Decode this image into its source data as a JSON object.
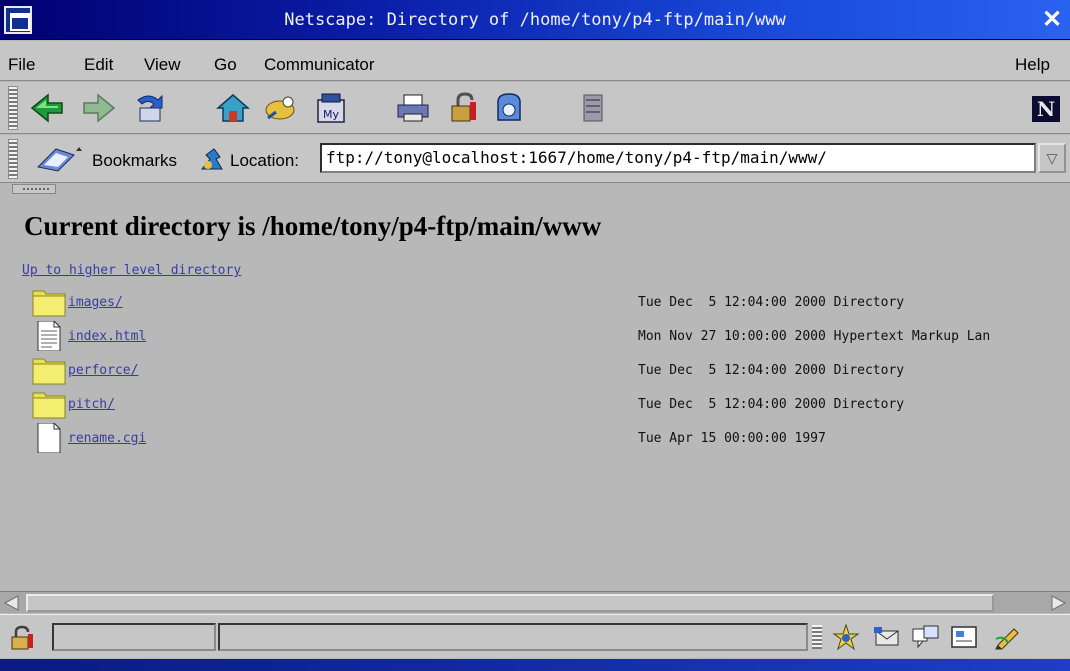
{
  "window": {
    "title": "Netscape: Directory of /home/tony/p4-ftp/main/www",
    "close_glyph": "✕"
  },
  "menu": {
    "items": [
      "File",
      "Edit",
      "View",
      "Go",
      "Communicator"
    ],
    "help": "Help"
  },
  "toolbar": {
    "buttons": [
      "back-icon",
      "forward-icon",
      "reload-icon",
      "home-icon",
      "search-icon",
      "my-netscape-icon",
      "print-icon",
      "security-icon",
      "shop-icon",
      "stop-icon"
    ],
    "my_label": "My",
    "brand_letter": "N"
  },
  "location_bar": {
    "bookmarks_label": "Bookmarks",
    "location_label": "Location:",
    "url": "ftp://tony@localhost:1667/home/tony/p4-ftp/main/www/"
  },
  "page": {
    "heading": "Current directory is /home/tony/p4-ftp/main/www",
    "up_link": "Up to higher level directory",
    "entries": [
      {
        "name": "images/",
        "icon": "folder-icon",
        "info": "Tue Dec  5 12:04:00 2000 Directory"
      },
      {
        "name": "index.html",
        "icon": "document-icon",
        "info": "Mon Nov 27 10:00:00 2000 Hypertext Markup Lan"
      },
      {
        "name": "perforce/",
        "icon": "folder-icon",
        "info": "Tue Dec  5 12:04:00 2000 Directory"
      },
      {
        "name": "pitch/",
        "icon": "folder-icon",
        "info": "Tue Dec  5 12:04:00 2000 Directory"
      },
      {
        "name": "rename.cgi",
        "icon": "file-icon",
        "info": "Tue Apr 15 00:00:00 1997"
      }
    ]
  },
  "status_bar": {
    "left_text": "",
    "main_text": "",
    "component_icons": [
      "navigator-icon",
      "mail-icon",
      "discussions-icon",
      "composer-icon",
      "edit-icon"
    ]
  },
  "colors": {
    "chrome": "#c6c6c6",
    "page_background": "#b8b8b8",
    "link": "#3a3aa8",
    "title_gradient_start": "#000070",
    "title_gradient_end": "#2a62f0"
  }
}
